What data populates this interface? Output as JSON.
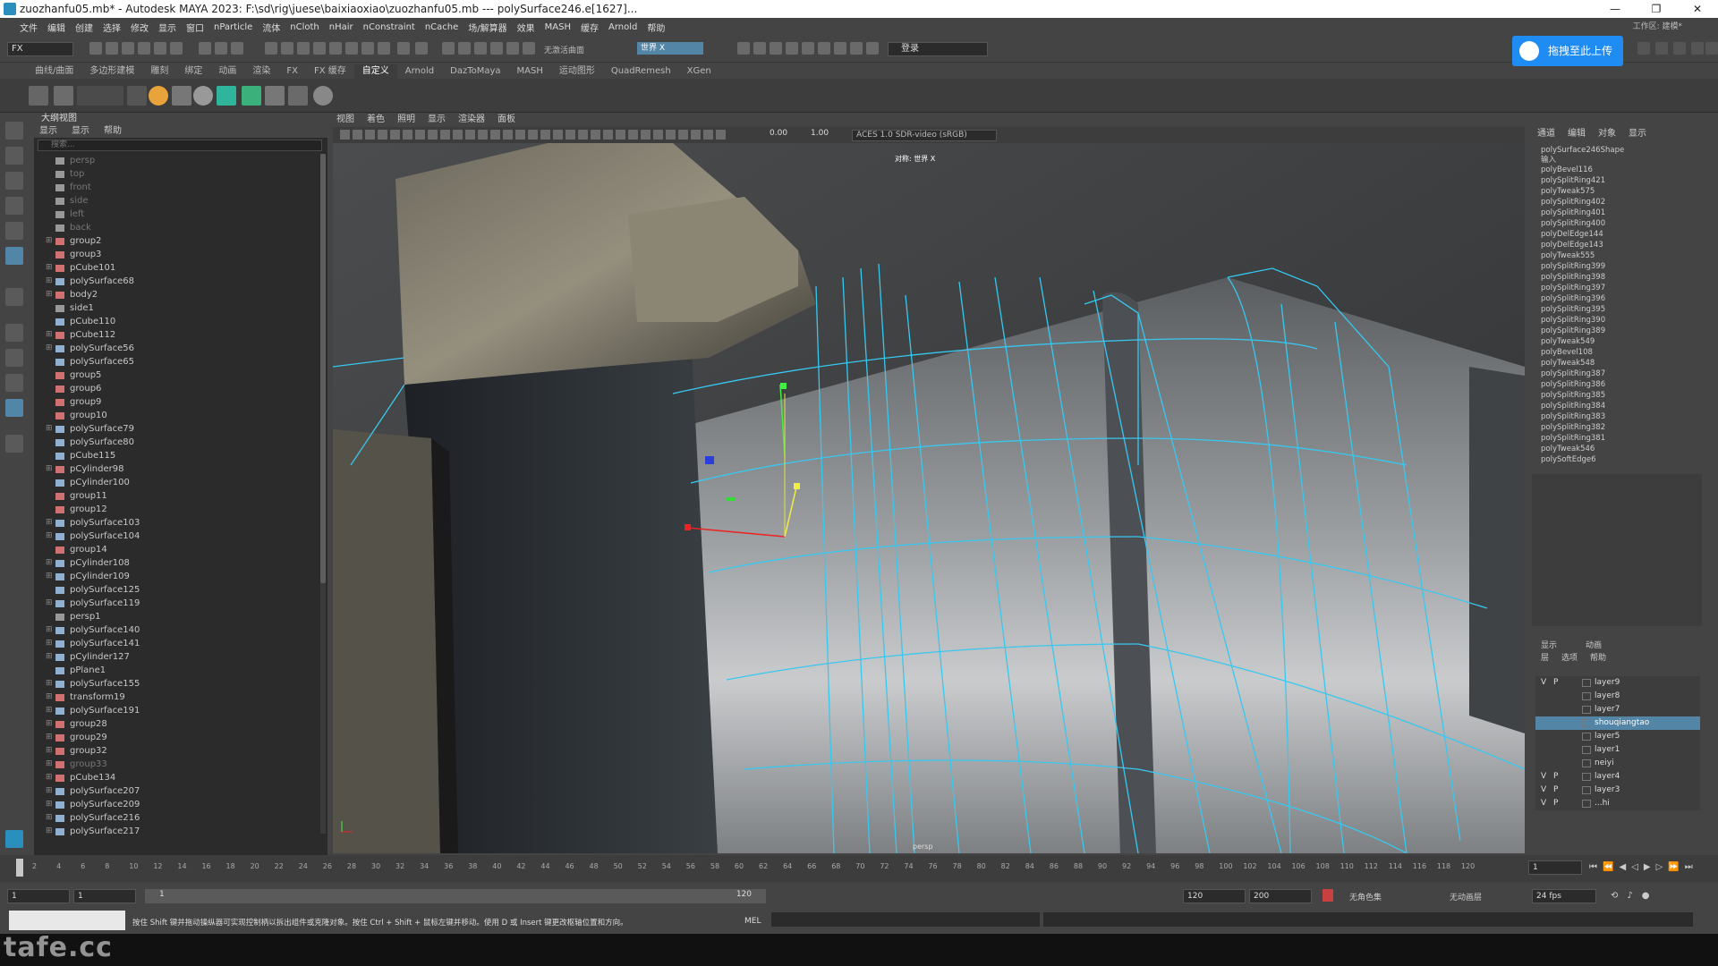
{
  "titlebar": {
    "title": "zuozhanfu05.mb* - Autodesk MAYA 2023: F:\\sd\\rig\\juese\\baixiaoxiao\\zuozhanfu05.mb   ---   polySurface246.e[1627]...",
    "min": "—",
    "max": "❐",
    "close": "✕"
  },
  "menubar": [
    "文件",
    "编辑",
    "创建",
    "选择",
    "修改",
    "显示",
    "窗口",
    "nParticle",
    "流体",
    "nCloth",
    "nHair",
    "nConstraint",
    "nCache",
    "场/解算器",
    "效果",
    "MASH",
    "缓存",
    "Arnold",
    "帮助"
  ],
  "workspace": "工作区: 建模*",
  "status": {
    "mode": "FX",
    "selection_field": "世界 X",
    "symmetry": "无激活曲面",
    "login": "登录"
  },
  "upload_button": "拖拽至此上传",
  "shelf_tabs": [
    "曲线/曲面",
    "多边形建模",
    "雕刻",
    "绑定",
    "动画",
    "渲染",
    "FX",
    "FX 缓存",
    "自定义",
    "Arnold",
    "DazToMaya",
    "MASH",
    "运动图形",
    "QuadRemesh",
    "XGen"
  ],
  "shelf_active": "自定义",
  "outliner": {
    "title": "大纲视图",
    "menu": [
      "显示",
      "显示",
      "帮助"
    ],
    "search_placeholder": "搜索...",
    "items": [
      {
        "name": "persp",
        "type": "cam",
        "dim": true
      },
      {
        "name": "top",
        "type": "cam",
        "dim": true
      },
      {
        "name": "front",
        "type": "cam",
        "dim": true
      },
      {
        "name": "side",
        "type": "cam",
        "dim": true
      },
      {
        "name": "left",
        "type": "cam",
        "dim": true
      },
      {
        "name": "back",
        "type": "cam",
        "dim": true
      },
      {
        "name": "group2",
        "type": "grp",
        "exp": true
      },
      {
        "name": "group3",
        "type": "grp"
      },
      {
        "name": "pCube101",
        "type": "grp",
        "exp": true
      },
      {
        "name": "polySurface68",
        "type": "mesh",
        "exp": true
      },
      {
        "name": "body2",
        "type": "grp",
        "exp": true
      },
      {
        "name": "side1",
        "type": "cam"
      },
      {
        "name": "pCube110",
        "type": "mesh"
      },
      {
        "name": "pCube112",
        "type": "grp",
        "exp": true
      },
      {
        "name": "polySurface56",
        "type": "mesh",
        "exp": true
      },
      {
        "name": "polySurface65",
        "type": "mesh"
      },
      {
        "name": "group5",
        "type": "grp"
      },
      {
        "name": "group6",
        "type": "grp"
      },
      {
        "name": "group9",
        "type": "grp"
      },
      {
        "name": "group10",
        "type": "grp"
      },
      {
        "name": "polySurface79",
        "type": "mesh",
        "exp": true
      },
      {
        "name": "polySurface80",
        "type": "mesh"
      },
      {
        "name": "pCube115",
        "type": "mesh"
      },
      {
        "name": "pCylinder98",
        "type": "grp",
        "exp": true
      },
      {
        "name": "pCylinder100",
        "type": "mesh"
      },
      {
        "name": "group11",
        "type": "grp"
      },
      {
        "name": "group12",
        "type": "grp"
      },
      {
        "name": "polySurface103",
        "type": "mesh",
        "exp": true
      },
      {
        "name": "polySurface104",
        "type": "mesh",
        "exp": true
      },
      {
        "name": "group14",
        "type": "grp"
      },
      {
        "name": "pCylinder108",
        "type": "mesh",
        "exp": true
      },
      {
        "name": "pCylinder109",
        "type": "mesh",
        "exp": true
      },
      {
        "name": "polySurface125",
        "type": "mesh"
      },
      {
        "name": "polySurface119",
        "type": "mesh",
        "exp": true
      },
      {
        "name": "persp1",
        "type": "cam"
      },
      {
        "name": "polySurface140",
        "type": "mesh",
        "exp": true
      },
      {
        "name": "polySurface141",
        "type": "mesh",
        "exp": true
      },
      {
        "name": "pCylinder127",
        "type": "mesh",
        "exp": true
      },
      {
        "name": "pPlane1",
        "type": "mesh"
      },
      {
        "name": "polySurface155",
        "type": "mesh",
        "exp": true
      },
      {
        "name": "transform19",
        "type": "grp",
        "exp": true
      },
      {
        "name": "polySurface191",
        "type": "mesh",
        "exp": true
      },
      {
        "name": "group28",
        "type": "grp",
        "exp": true
      },
      {
        "name": "group29",
        "type": "grp",
        "exp": true
      },
      {
        "name": "group32",
        "type": "grp",
        "exp": true
      },
      {
        "name": "group33",
        "type": "grp",
        "exp": true,
        "dim": true
      },
      {
        "name": "pCube134",
        "type": "grp",
        "exp": true
      },
      {
        "name": "polySurface207",
        "type": "mesh",
        "exp": true
      },
      {
        "name": "polySurface209",
        "type": "mesh",
        "exp": true
      },
      {
        "name": "polySurface216",
        "type": "mesh",
        "exp": true
      },
      {
        "name": "polySurface217",
        "type": "mesh",
        "exp": true
      }
    ]
  },
  "viewport": {
    "menu": [
      "视图",
      "着色",
      "照明",
      "显示",
      "渲染器",
      "面板"
    ],
    "exposure": "0.00",
    "gamma": "1.00",
    "colorspace": "ACES 1.0 SDR-video (sRGB)",
    "camera_label": "对称: 世界 X",
    "persp_label": "persp"
  },
  "channelbox": {
    "tabs": [
      "通道",
      "编辑",
      "对象",
      "显示"
    ],
    "header": "polySurface246Shape",
    "inputs_label": "输入",
    "history": [
      "polyBevel116",
      "polySplitRing421",
      "polyTweak575",
      "polySplitRing402",
      "polySplitRing401",
      "polySplitRing400",
      "polyDelEdge144",
      "polyDelEdge143",
      "polyTweak555",
      "polySplitRing399",
      "polySplitRing398",
      "polySplitRing397",
      "polySplitRing396",
      "polySplitRing395",
      "polySplitRing390",
      "polySplitRing389",
      "polyTweak549",
      "polyBevel108",
      "polyTweak548",
      "polySplitRing387",
      "polySplitRing386",
      "polySplitRing385",
      "polySplitRing384",
      "polySplitRing383",
      "polySplitRing382",
      "polySplitRing381",
      "polyTweak546",
      "polySoftEdge6"
    ]
  },
  "layers": {
    "tabs": [
      "显示",
      "动画"
    ],
    "menu": [
      "层",
      "选项",
      "帮助"
    ],
    "rows": [
      {
        "v": "V",
        "p": "P",
        "name": "layer9",
        "sel": false
      },
      {
        "v": "",
        "p": "",
        "name": "layer8",
        "sel": false
      },
      {
        "v": "",
        "p": "",
        "name": "layer7",
        "sel": false
      },
      {
        "v": "",
        "p": "",
        "name": "shouqiangtao",
        "sel": true
      },
      {
        "v": "",
        "p": "",
        "name": "layer5",
        "sel": false
      },
      {
        "v": "",
        "p": "",
        "name": "layer1",
        "sel": false
      },
      {
        "v": "",
        "p": "",
        "name": "neiyi",
        "sel": false
      },
      {
        "v": "V",
        "p": "P",
        "name": "layer4",
        "sel": false
      },
      {
        "v": "V",
        "p": "P",
        "name": "layer3",
        "sel": false
      },
      {
        "v": "V",
        "p": "P",
        "name": "...hi",
        "sel": false
      }
    ]
  },
  "timeline": {
    "ticks": [
      "2",
      "4",
      "6",
      "8",
      "10",
      "12",
      "14",
      "16",
      "18",
      "20",
      "22",
      "24",
      "26",
      "28",
      "30",
      "32",
      "34",
      "36",
      "38",
      "40",
      "42",
      "44",
      "46",
      "48",
      "50",
      "52",
      "54",
      "56",
      "58",
      "60",
      "62",
      "64",
      "66",
      "68",
      "70",
      "72",
      "74",
      "76",
      "78",
      "80",
      "82",
      "84",
      "86",
      "88",
      "90",
      "92",
      "94",
      "96",
      "98",
      "100",
      "102",
      "104",
      "106",
      "108",
      "110",
      "112",
      "114",
      "116",
      "118",
      "120"
    ],
    "current_frame": "1"
  },
  "range": {
    "start": "1",
    "anim_start": "1",
    "slider_start": "1",
    "slider_end": "120",
    "end": "120",
    "anim_end": "200",
    "char_set": "无角色集",
    "anim_layer": "无动画层",
    "fps": "24 fps"
  },
  "helpline": {
    "text": "按住 Shift 键并拖动操纵器可实现控制柄以拆出组件或克隆对象。按住 Ctrl + Shift + 鼠标左键并移动。使用 D 或 Insert 键更改枢轴位置和方向。",
    "mel_label": "MEL"
  },
  "watermark": "tafe.cc"
}
